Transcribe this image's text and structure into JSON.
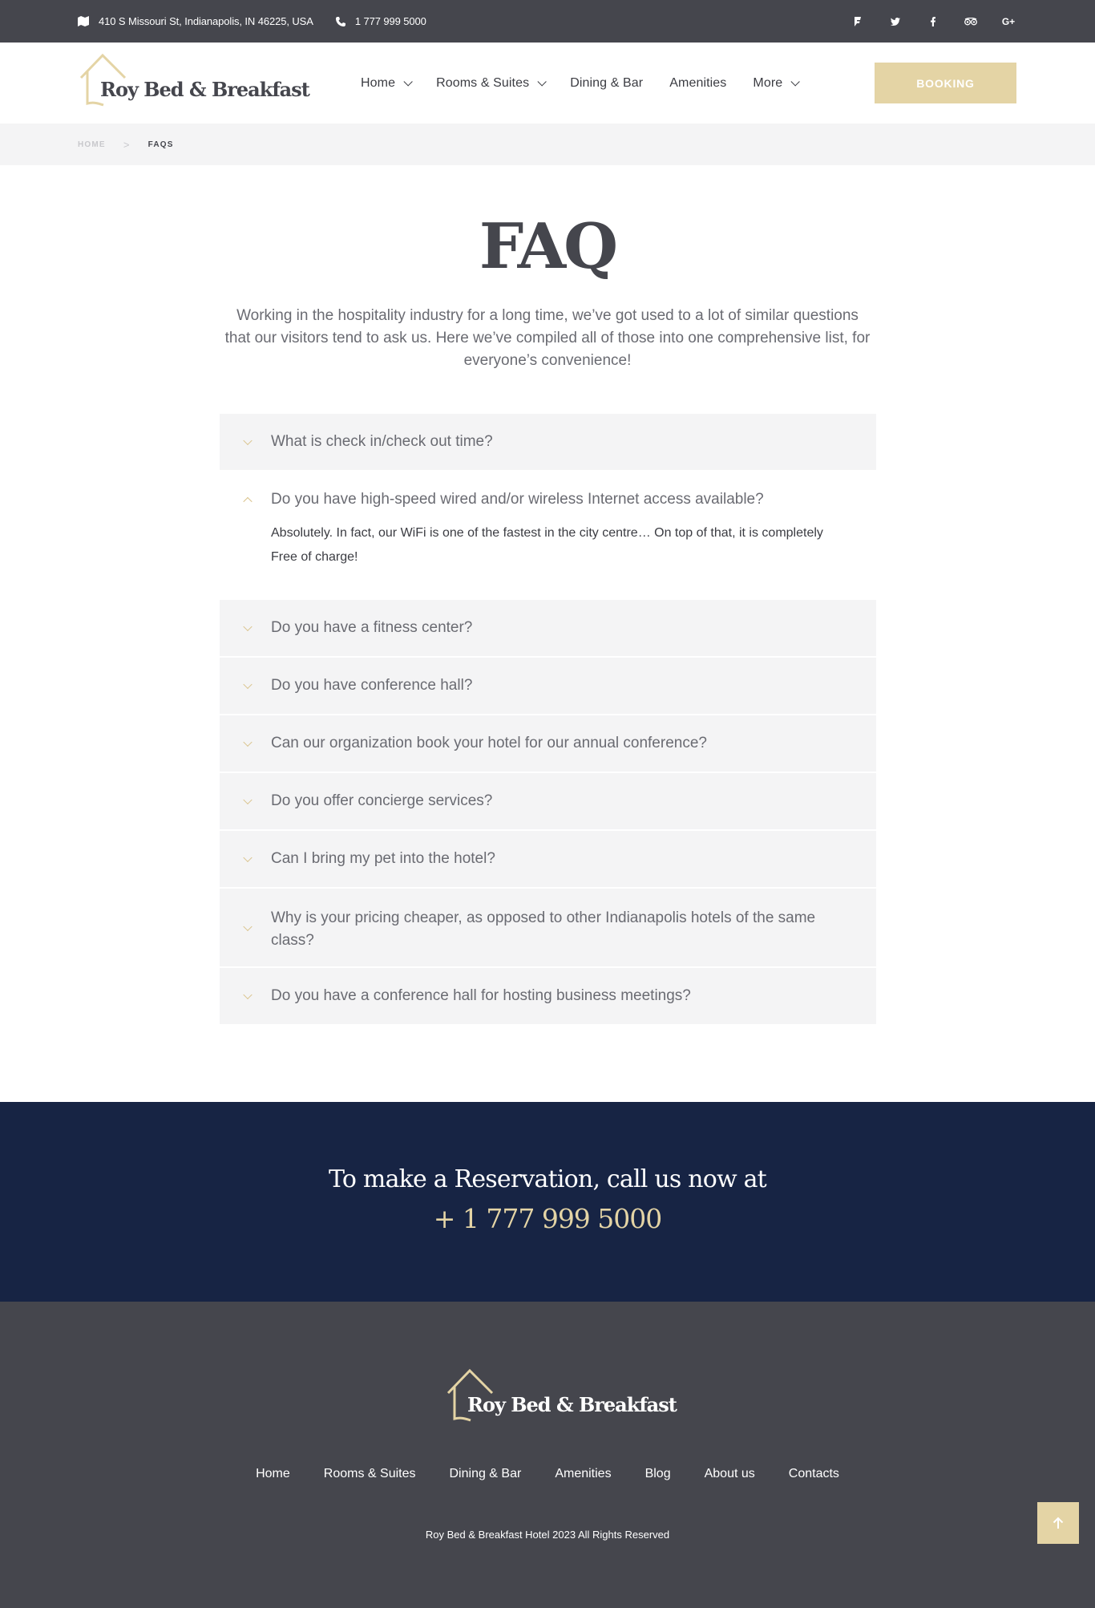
{
  "topbar": {
    "address": "410 S Missouri St, Indianapolis, IN 46225, USA",
    "phone": "1 777 999 5000",
    "social": [
      "foursquare-icon",
      "twitter-icon",
      "facebook-icon",
      "tripadvisor-icon",
      "google-plus-icon"
    ]
  },
  "brand": {
    "name": "Roy Bed & Breakfast",
    "accent": "#e4d4a5",
    "dark": "#45464d",
    "navy": "#172444"
  },
  "nav": {
    "items": [
      {
        "label": "Home"
      },
      {
        "label": "Rooms & Suites"
      },
      {
        "label": "Dining & Bar"
      },
      {
        "label": "Amenities"
      },
      {
        "label": "More"
      }
    ],
    "booking": "BOOKING"
  },
  "breadcrumb": {
    "home": "HOME",
    "current": "FAQS"
  },
  "faq": {
    "title": "FAQ",
    "intro": "Working in the hospitality industry for a long time, we’ve got used to a lot of similar questions that our visitors tend to ask us. Here we’ve compiled all of those into one comprehensive list, for everyone’s convenience!",
    "items": [
      {
        "q": "What is check in/check out time?"
      },
      {
        "q": "Do you have high-speed wired and/or wireless Internet access available?",
        "a": "Absolutely. In fact, our WiFi is one of the fastest in the city centre… On top of that, it is completely Free of charge!"
      },
      {
        "q": "Do you have a fitness center?"
      },
      {
        "q": "Do you have conference hall?"
      },
      {
        "q": "Can our organization book your hotel for our annual conference?"
      },
      {
        "q": "Do you offer concierge services?"
      },
      {
        "q": "Can I bring my pet into the hotel?"
      },
      {
        "q": "Why is your pricing cheaper, as opposed to other Indianapolis hotels of the same class?"
      },
      {
        "q": "Do you have a conference hall for hosting business meetings?"
      }
    ]
  },
  "reservation": {
    "line": "To make a Reservation, call us now at",
    "phone": "+ 1 777 999 5000"
  },
  "footer": {
    "nav": [
      "Home",
      "Rooms & Suites",
      "Dining & Bar",
      "Amenities",
      "Blog",
      "About us",
      "Contacts"
    ],
    "copyright": "Roy Bed & Breakfast Hotel 2023 All Rights Reserved"
  }
}
